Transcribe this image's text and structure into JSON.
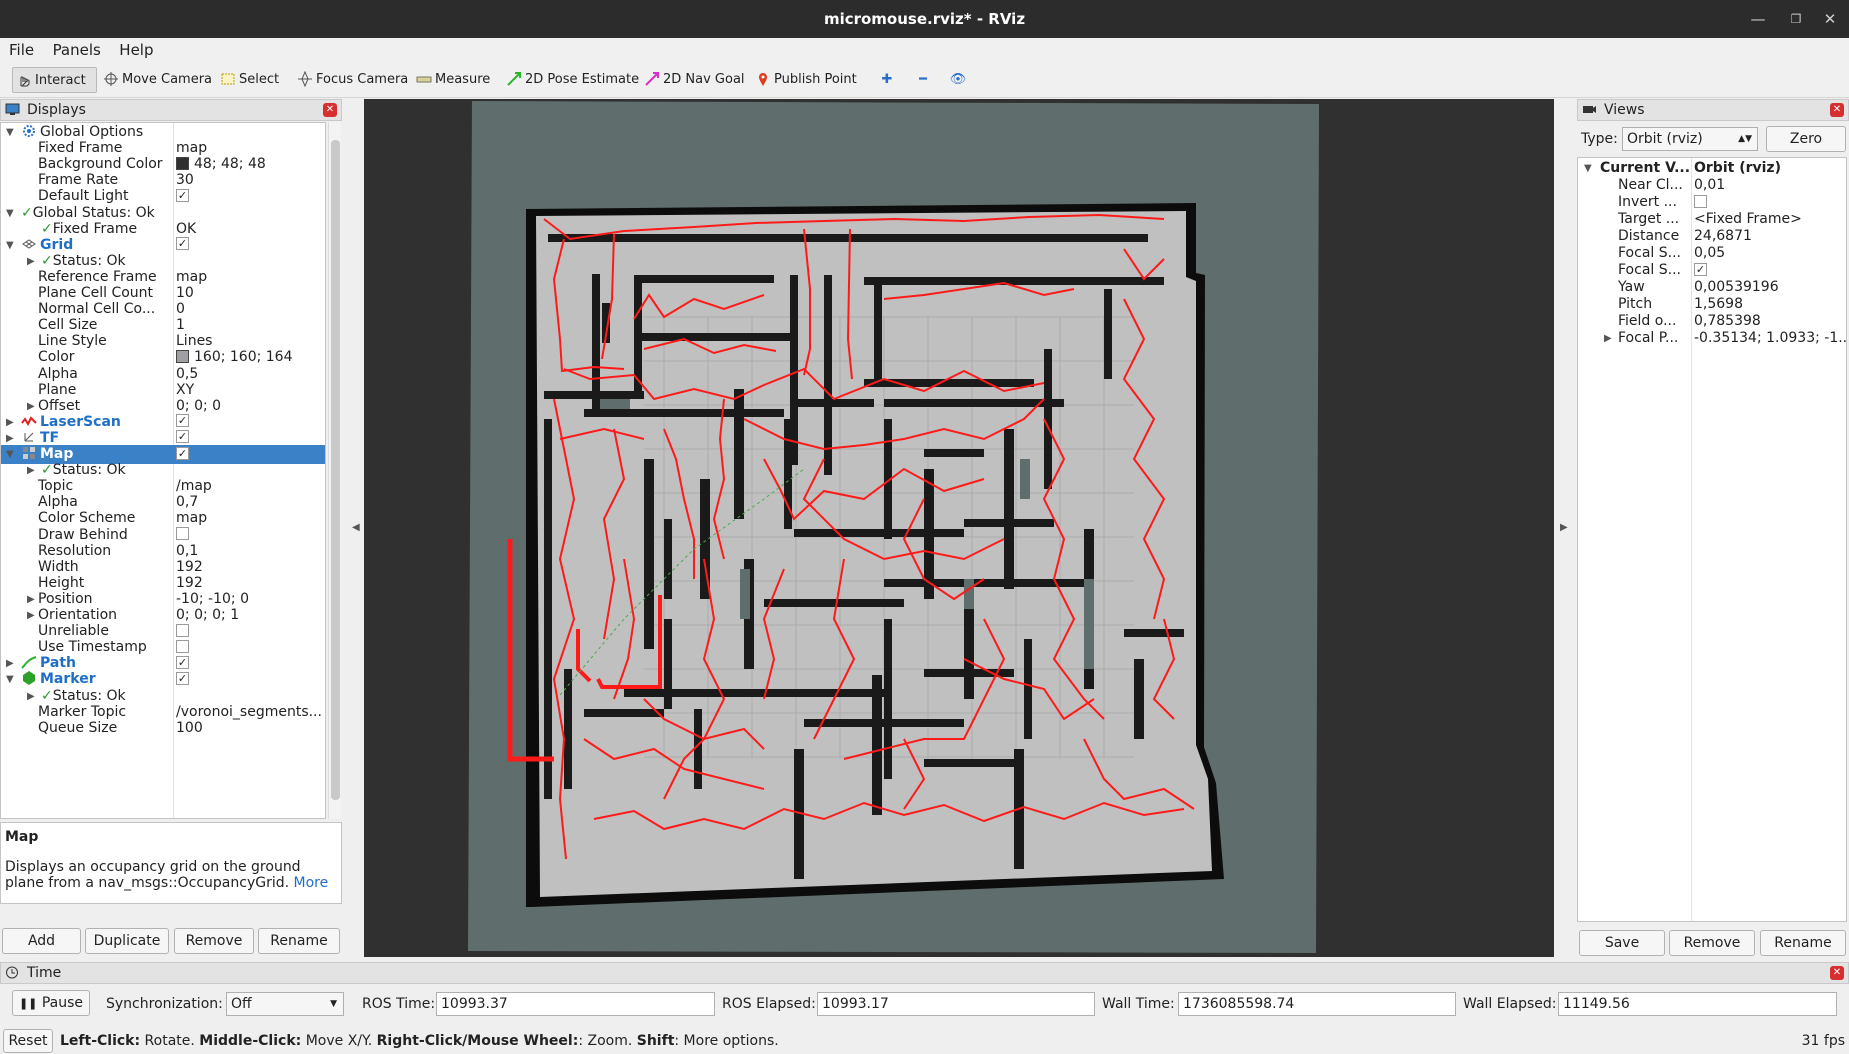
{
  "window": {
    "title": "micromouse.rviz* - RViz"
  },
  "menu": [
    "File",
    "Panels",
    "Help"
  ],
  "toolbar": {
    "interact": "Interact",
    "move_camera": "Move Camera",
    "select": "Select",
    "focus_camera": "Focus Camera",
    "measure": "Measure",
    "pose_estimate": "2D Pose Estimate",
    "nav_goal": "2D Nav Goal",
    "publish_point": "Publish Point"
  },
  "displays": {
    "title": "Displays",
    "rows": [
      {
        "name": "Global Options",
        "value": "",
        "kind": "group",
        "icon": "gear-icon"
      },
      {
        "name": "Fixed Frame",
        "value": "map"
      },
      {
        "name": "Background Color",
        "value": "48; 48; 48",
        "swatch": "#303030"
      },
      {
        "name": "Frame Rate",
        "value": "30"
      },
      {
        "name": "Default Light",
        "value": "",
        "check": true
      },
      {
        "name": "Global Status: Ok",
        "value": "",
        "kind": "group",
        "icon": "check-icon"
      },
      {
        "name": "Fixed Frame",
        "value": "OK",
        "icon": "check-icon",
        "indent": 2
      },
      {
        "name": "Grid",
        "value": "",
        "kind": "display",
        "icon": "grid-icon",
        "check": true
      },
      {
        "name": "Status: Ok",
        "value": "",
        "icon": "check-icon",
        "indent": 2,
        "expand": "collapsed"
      },
      {
        "name": "Reference Frame",
        "value": "map"
      },
      {
        "name": "Plane Cell Count",
        "value": "10"
      },
      {
        "name": "Normal Cell Co...",
        "value": "0"
      },
      {
        "name": "Cell Size",
        "value": "1"
      },
      {
        "name": "Line Style",
        "value": "Lines"
      },
      {
        "name": "Color",
        "value": "160; 160; 164",
        "swatch": "#a0a0a4"
      },
      {
        "name": "Alpha",
        "value": "0,5"
      },
      {
        "name": "Plane",
        "value": "XY"
      },
      {
        "name": "Offset",
        "value": "0; 0; 0",
        "expand": "collapsed"
      },
      {
        "name": "LaserScan",
        "value": "",
        "kind": "display",
        "icon": "laserscan-icon",
        "check": true,
        "expand": "collapsed"
      },
      {
        "name": "TF",
        "value": "",
        "kind": "display",
        "icon": "tf-icon",
        "check": true,
        "expand": "collapsed"
      },
      {
        "name": "Map",
        "value": "",
        "kind": "display",
        "icon": "map-icon",
        "check": true,
        "selected": true
      },
      {
        "name": "Status: Ok",
        "value": "",
        "icon": "check-icon",
        "indent": 2,
        "expand": "collapsed"
      },
      {
        "name": "Topic",
        "value": "/map"
      },
      {
        "name": "Alpha",
        "value": "0,7"
      },
      {
        "name": "Color Scheme",
        "value": "map"
      },
      {
        "name": "Draw Behind",
        "value": "",
        "check": false
      },
      {
        "name": "Resolution",
        "value": "0,1"
      },
      {
        "name": "Width",
        "value": "192"
      },
      {
        "name": "Height",
        "value": "192"
      },
      {
        "name": "Position",
        "value": "-10; -10; 0",
        "expand": "collapsed"
      },
      {
        "name": "Orientation",
        "value": "0; 0; 0; 1",
        "expand": "collapsed"
      },
      {
        "name": "Unreliable",
        "value": "",
        "check": false
      },
      {
        "name": "Use Timestamp",
        "value": "",
        "check": false
      },
      {
        "name": "Path",
        "value": "",
        "kind": "display",
        "icon": "path-icon",
        "check": true,
        "expand": "collapsed"
      },
      {
        "name": "Marker",
        "value": "",
        "kind": "display",
        "icon": "marker-icon",
        "check": true
      },
      {
        "name": "Status: Ok",
        "value": "",
        "icon": "check-icon",
        "indent": 2,
        "expand": "collapsed"
      },
      {
        "name": "Marker Topic",
        "value": "/voronoi_segments..."
      },
      {
        "name": "Queue Size",
        "value": "100"
      }
    ],
    "description_title": "Map",
    "description_text": "Displays an occupancy grid on the ground plane from a nav_msgs::OccupancyGrid.",
    "description_link": "More",
    "buttons": [
      "Add",
      "Duplicate",
      "Remove",
      "Rename"
    ]
  },
  "views": {
    "title": "Views",
    "type_label": "Type:",
    "type_value": "Orbit (rviz)",
    "zero_label": "Zero",
    "header": {
      "name": "Current V...",
      "value": "Orbit (rviz)"
    },
    "rows": [
      {
        "name": "Near Cl...",
        "value": "0,01"
      },
      {
        "name": "Invert ...",
        "value": "",
        "check": false
      },
      {
        "name": "Target ...",
        "value": "<Fixed Frame>"
      },
      {
        "name": "Distance",
        "value": "24,6871"
      },
      {
        "name": "Focal S...",
        "value": "0,05"
      },
      {
        "name": "Focal S...",
        "value": "",
        "check": true
      },
      {
        "name": "Yaw",
        "value": "0,00539196"
      },
      {
        "name": "Pitch",
        "value": "1,5698"
      },
      {
        "name": "Field o...",
        "value": "0,785398"
      },
      {
        "name": "Focal P...",
        "value": "-0.35134; 1.0933; -1....",
        "expand": "collapsed"
      }
    ],
    "buttons": [
      "Save",
      "Remove",
      "Rename"
    ]
  },
  "time": {
    "title": "Time",
    "pause": "Pause",
    "sync_label": "Synchronization:",
    "sync_value": "Off",
    "ros_time_label": "ROS Time:",
    "ros_time": "10993.37",
    "ros_elapsed_label": "ROS Elapsed:",
    "ros_elapsed": "10993.17",
    "wall_time_label": "Wall Time:",
    "wall_time": "1736085598.74",
    "wall_elapsed_label": "Wall Elapsed:",
    "wall_elapsed": "11149.56"
  },
  "status": {
    "reset": "Reset",
    "hint": [
      {
        "b": "Left-Click:",
        "t": " Rotate. "
      },
      {
        "b": "Middle-Click:",
        "t": " Move X/Y. "
      },
      {
        "b": "Right-Click/Mouse Wheel:",
        "t": ": Zoom. "
      },
      {
        "b": "Shift",
        "t": ": More options."
      }
    ],
    "fps": "31 fps"
  },
  "colors": {
    "selection": "#3a81c7",
    "voronoi": "#ff1a1a",
    "map_free": "#c0c0c0",
    "map_unknown": "#5f6e6c",
    "map_wall": "#0c0c0c"
  }
}
